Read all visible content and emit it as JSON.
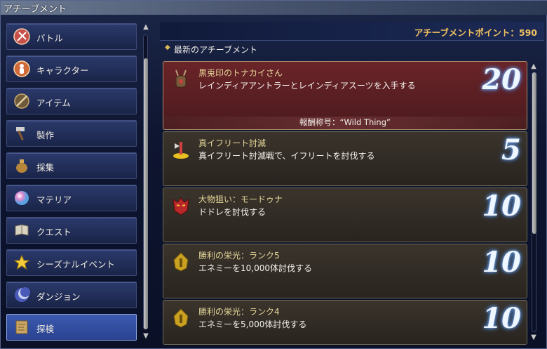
{
  "window": {
    "title": "アチーブメント"
  },
  "points": {
    "label": "アチーブメントポイント：590"
  },
  "section": {
    "title": "最新のアチーブメント"
  },
  "sidebar": {
    "items": [
      {
        "label": "バトル",
        "icon": "battle-icon"
      },
      {
        "label": "キャラクター",
        "icon": "character-icon"
      },
      {
        "label": "アイテム",
        "icon": "item-icon"
      },
      {
        "label": "製作",
        "icon": "crafting-hammer-icon"
      },
      {
        "label": "採集",
        "icon": "gathering-sack-icon"
      },
      {
        "label": "マテリア",
        "icon": "materia-orb-icon"
      },
      {
        "label": "クエスト",
        "icon": "quest-book-icon"
      },
      {
        "label": "シーズナルイベント",
        "icon": "star-icon"
      },
      {
        "label": "ダンジョン",
        "icon": "dungeon-moon-icon"
      },
      {
        "label": "探検",
        "icon": "map-scroll-icon"
      }
    ],
    "selected": "探検"
  },
  "achievements": [
    {
      "name": "黒兎印のトナカイさん",
      "desc": "レインディアアントラーとレインディアスーツを入手する",
      "points": "20",
      "reward": "報酬称号：“Wild Thing”",
      "icon": "reindeer-antler-icon"
    },
    {
      "name": "真イフリート討滅",
      "desc": "真イフリート討滅戦で、イフリートを討伐する",
      "points": "5",
      "icon": "ifrit-axe-icon"
    },
    {
      "name": "大物狙い：モードゥナ",
      "desc": "ドドレを討伐する",
      "points": "10",
      "icon": "red-demon-mask-icon"
    },
    {
      "name": "勝利の栄光：ランク5",
      "desc": "エネミーを10,000体討伐する",
      "points": "10",
      "icon": "gold-helmet-icon"
    },
    {
      "name": "勝利の栄光：ランク4",
      "desc": "エネミーを5,000体討伐する",
      "points": "10",
      "icon": "gold-helmet-icon"
    }
  ],
  "colors": {
    "highlight_row": "#6a2428",
    "points_text": "#f0c060",
    "name_text": "#e7d79a"
  }
}
